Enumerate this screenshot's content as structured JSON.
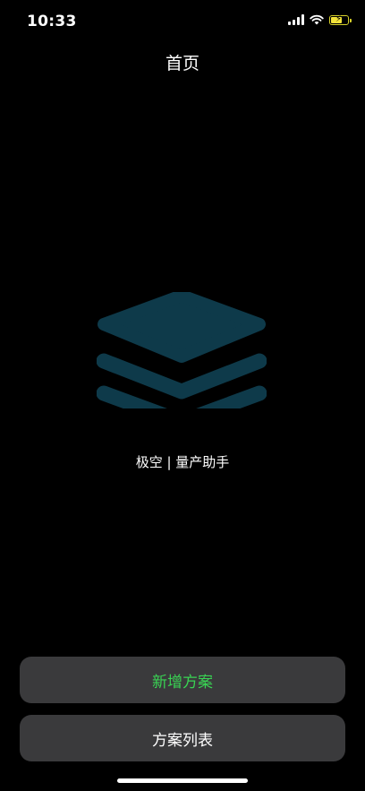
{
  "status_bar": {
    "time": "10:33",
    "icons": [
      "signal-icon",
      "wifi-icon",
      "battery-charging-icon"
    ],
    "battery_level": 0.75,
    "battery_color": "#f3e33a"
  },
  "header": {
    "title": "首页"
  },
  "hero": {
    "logo_icon": "layers-icon",
    "logo_color": "#0e3a4a",
    "app_name": "极空 | 量产助手"
  },
  "actions": {
    "new_plan_label": "新增方案",
    "new_plan_color": "#39d353",
    "plan_list_label": "方案列表",
    "button_bg": "#3a3a3c"
  }
}
